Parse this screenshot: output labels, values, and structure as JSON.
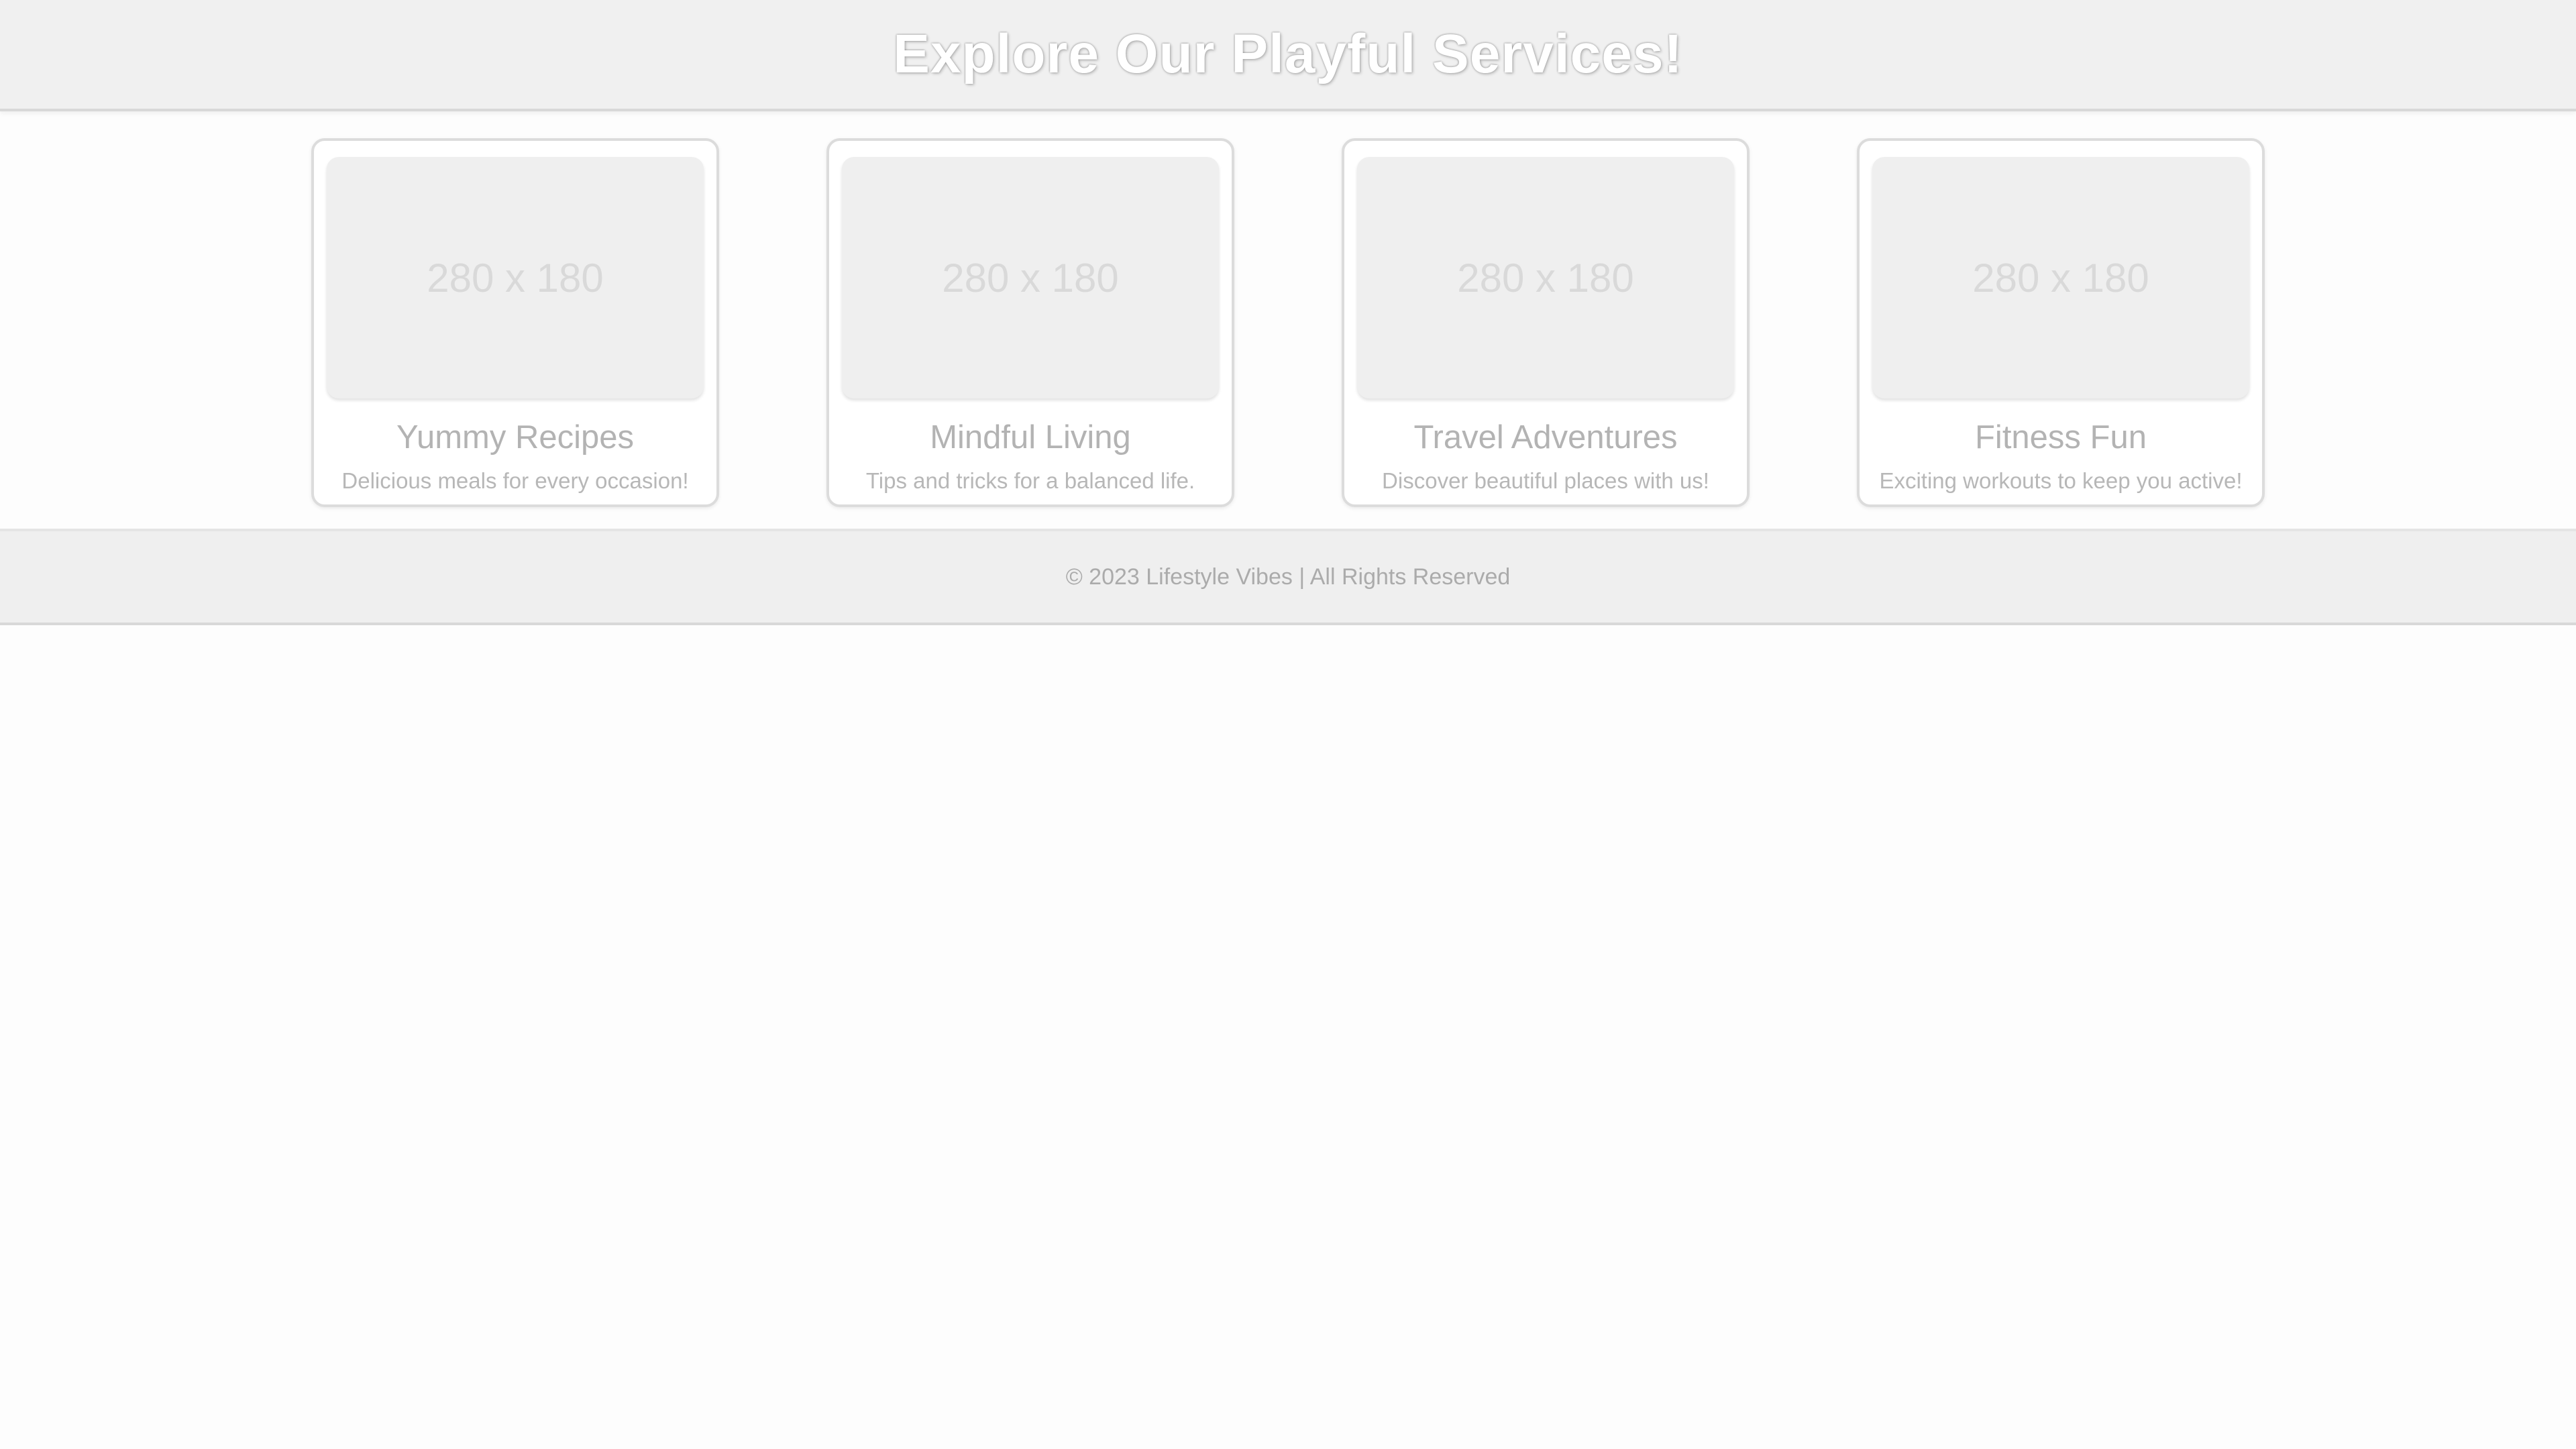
{
  "header": {
    "title": "Explore Our Playful Services!"
  },
  "services": [
    {
      "image_placeholder": "280 x 180",
      "title": "Yummy Recipes",
      "description": "Delicious meals for every occasion!"
    },
    {
      "image_placeholder": "280 x 180",
      "title": "Mindful Living",
      "description": "Tips and tricks for a balanced life."
    },
    {
      "image_placeholder": "280 x 180",
      "title": "Travel Adventures",
      "description": "Discover beautiful places with us!"
    },
    {
      "image_placeholder": "280 x 180",
      "title": "Fitness Fun",
      "description": "Exciting workouts to keep you active!"
    }
  ],
  "footer": {
    "text": "© 2023 Lifestyle Vibes | All Rights Reserved"
  }
}
